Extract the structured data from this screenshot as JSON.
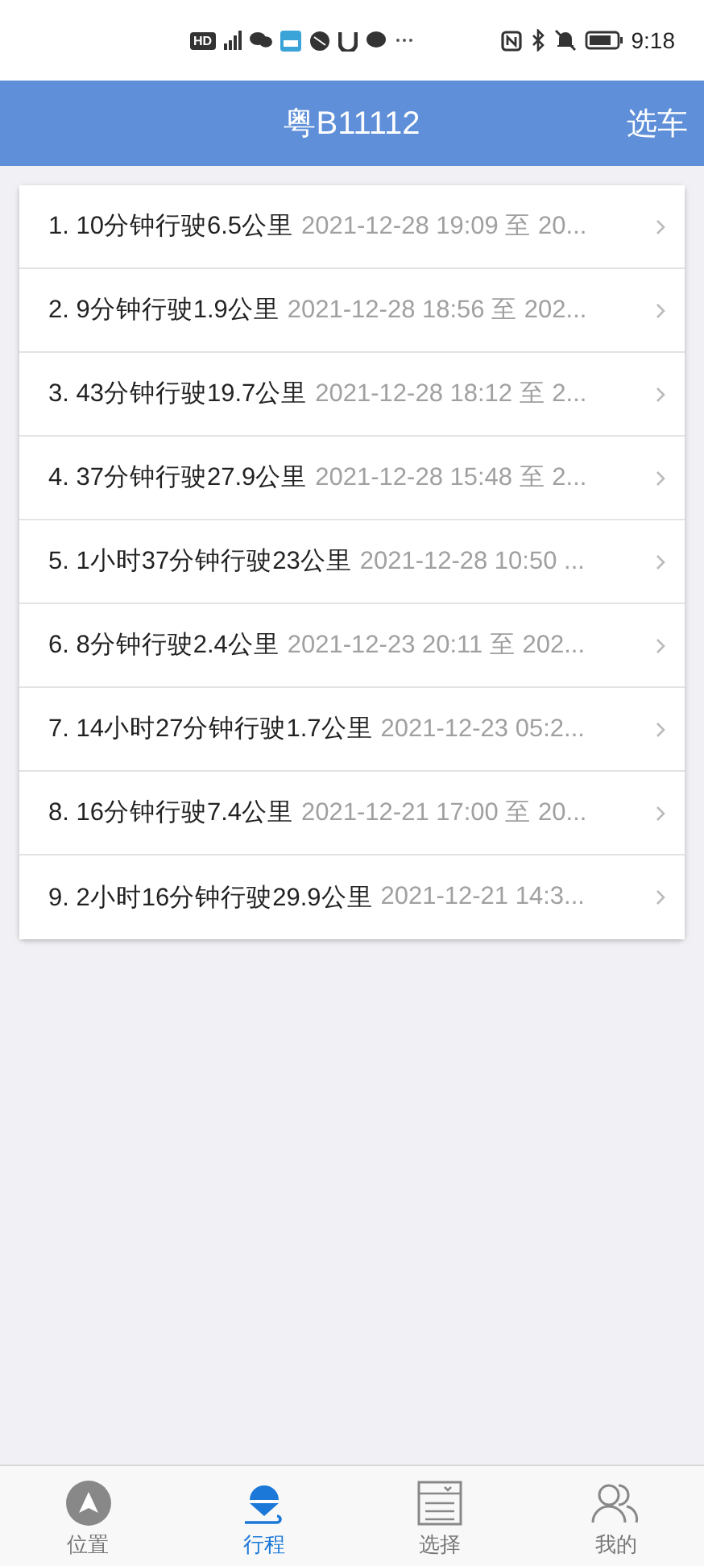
{
  "status_bar": {
    "left_icons": [
      "HD"
    ],
    "time": "9:18"
  },
  "header": {
    "title": "粤B11112",
    "action": "选车"
  },
  "trips": [
    {
      "index": "1.",
      "summary": "10分钟行驶6.5公里",
      "time": "2021-12-28 19:09 至 20..."
    },
    {
      "index": "2.",
      "summary": "9分钟行驶1.9公里",
      "time": "2021-12-28 18:56 至 202..."
    },
    {
      "index": "3.",
      "summary": "43分钟行驶19.7公里",
      "time": "2021-12-28 18:12 至 2..."
    },
    {
      "index": "4.",
      "summary": "37分钟行驶27.9公里",
      "time": "2021-12-28 15:48 至 2..."
    },
    {
      "index": "5.",
      "summary": "1小时37分钟行驶23公里",
      "time": "2021-12-28 10:50 ..."
    },
    {
      "index": "6.",
      "summary": "8分钟行驶2.4公里",
      "time": "2021-12-23 20:11 至 202..."
    },
    {
      "index": "7.",
      "summary": "14小时27分钟行驶1.7公里",
      "time": "2021-12-23 05:2..."
    },
    {
      "index": "8.",
      "summary": "16分钟行驶7.4公里",
      "time": "2021-12-21 17:00 至 20..."
    },
    {
      "index": "9.",
      "summary": "2小时16分钟行驶29.9公里",
      "time": "2021-12-21 14:3..."
    }
  ],
  "tab_bar": [
    {
      "kind": "location",
      "label": "位置",
      "selected": false
    },
    {
      "kind": "trip",
      "label": "行程",
      "selected": true
    },
    {
      "kind": "select",
      "label": "选择",
      "selected": false
    },
    {
      "kind": "profile",
      "label": "我的",
      "selected": false
    }
  ]
}
